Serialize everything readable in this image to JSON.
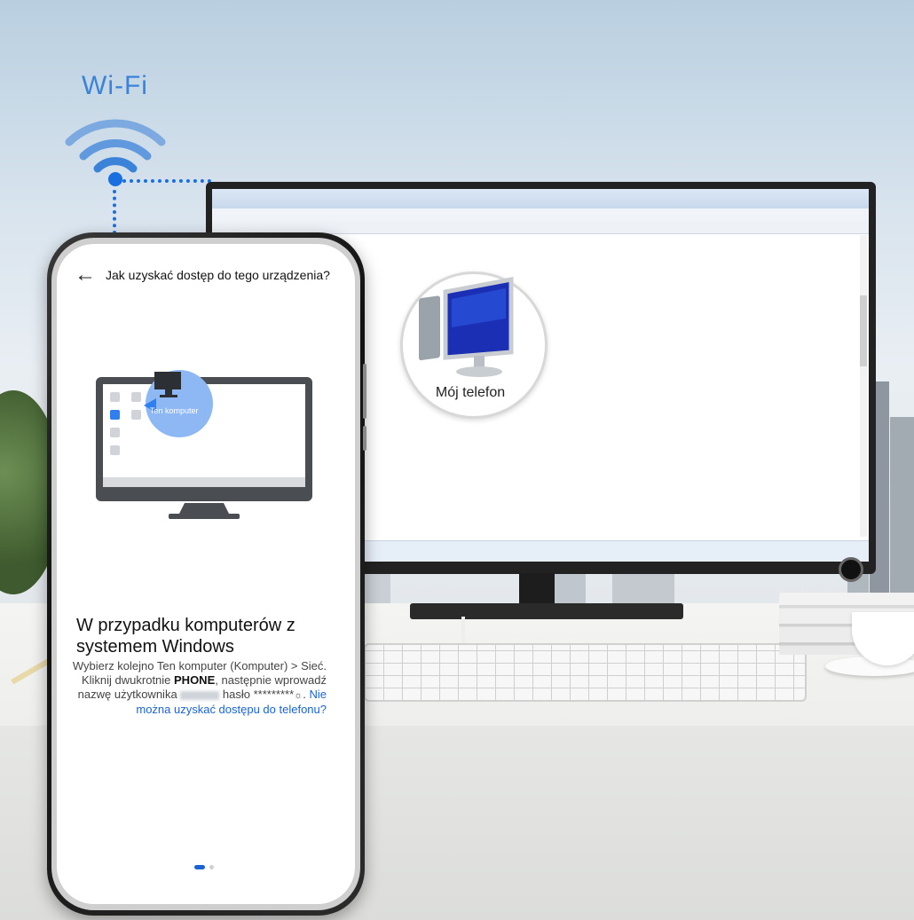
{
  "wifi": {
    "label": "Wi-Fi",
    "color": "#3b82d9"
  },
  "computer_window": {
    "icon_label": "Mój telefon"
  },
  "phone": {
    "header": {
      "title": "Jak uzyskać dostęp do tego urządzenia?"
    },
    "illustration": {
      "tooltip": "Ten komputer"
    },
    "section": {
      "title": "W przypadku komputerów z systemem Windows",
      "desc_part1": "Wybierz kolejno Ten komputer (Komputer) > Sieć. Kliknij dwukrotnie ",
      "desc_bold": "PHONE",
      "desc_part2": ", następnie wprowadź nazwę użytkownika ",
      "desc_part3": " hasło ",
      "desc_password": "*********",
      "desc_part4": ". ",
      "desc_link": "Nie można uzyskać dostępu do telefonu?"
    },
    "pagination": {
      "current": 1,
      "total": 2
    }
  },
  "colors": {
    "accent": "#1a63d6",
    "wifi_line": "#1a6fe0"
  }
}
